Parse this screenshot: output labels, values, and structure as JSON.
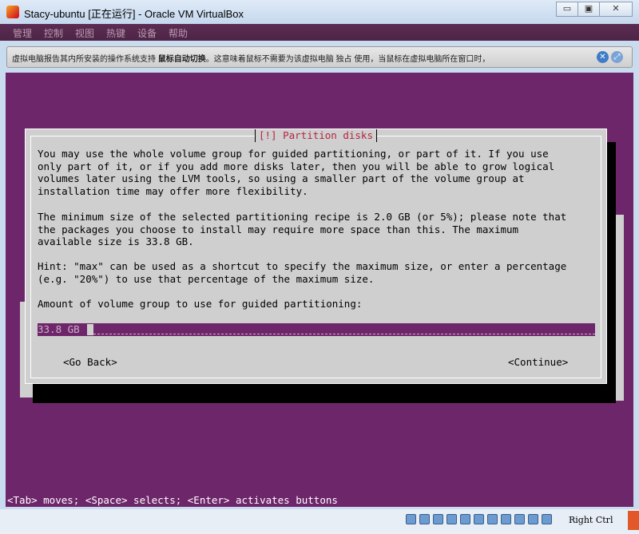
{
  "window": {
    "title": "Stacy-ubuntu [正在运行] - Oracle VM VirtualBox",
    "minimize": "▭",
    "maximize": "▣",
    "close": "✕"
  },
  "menu": [
    "管理",
    "控制",
    "视图",
    "热键",
    "设备",
    "帮助"
  ],
  "notification": {
    "text_before": "虚拟电脑报告其内所安装的操作系统支持 ",
    "text_bold": "鼠标自动切换",
    "text_after": "。这意味着鼠标不需要为该虚拟电脑 独占 使用，当鼠标在虚拟电脑所在窗口时，",
    "close_icon": "✕",
    "mouse_icon": "⤢"
  },
  "installer": {
    "dialog_title": "[!] Partition disks",
    "paragraph1": "You may use the whole volume group for guided partitioning, or part of it. If you use\nonly part of it, or if you add more disks later, then you will be able to grow logical\nvolumes later using the LVM tools, so using a smaller part of the volume group at\ninstallation time may offer more flexibility.",
    "paragraph2": "The minimum size of the selected partitioning recipe is 2.0 GB (or 5%); please note that\nthe packages you choose to install may require more space than this. The maximum\navailable size is 33.8 GB.",
    "paragraph3": "Hint: \"max\" can be used as a shortcut to specify the maximum size, or enter a percentage\n(e.g. \"20%\") to use that percentage of the maximum size.",
    "prompt": "Amount of volume group to use for guided partitioning:",
    "input_value": "33.8 GB",
    "go_back": "<Go Back>",
    "continue": "<Continue>",
    "help_line": "<Tab> moves; <Space> selects; <Enter> activates buttons"
  },
  "statusbar": {
    "host_key": "Right Ctrl"
  },
  "colors": {
    "console_bg": "#6e266a",
    "dialog_bg": "#cfcfcf",
    "title_red": "#b5263f"
  }
}
